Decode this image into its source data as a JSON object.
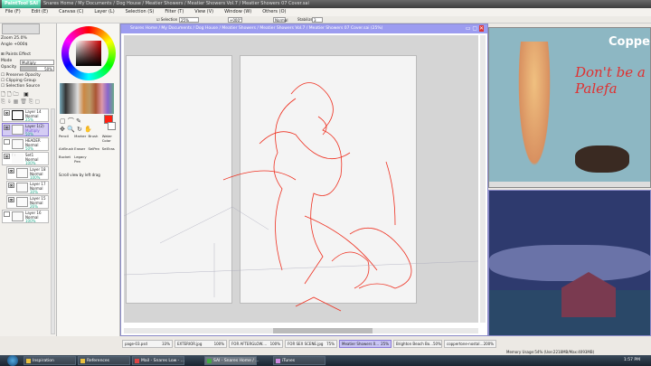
{
  "app": {
    "logo": "PaintTool SAI",
    "title": "Snares Home / My Documents / Dog House / Meatier Showers / Meatier Showers Vol.7 / Meatier Showers 07 Cover.sai"
  },
  "menu": [
    "File (F)",
    "Edit (E)",
    "Canvas (C)",
    "Layer (L)",
    "Selection (S)",
    "Filter (T)",
    "View (V)",
    "Window (W)",
    "Others (O)"
  ],
  "toolbar": {
    "selection_label": "Selection",
    "zoom": "25%",
    "angle": "+000°",
    "blend": "Normal",
    "stabilizer_label": "Stabilizer",
    "stabilizer": "3"
  },
  "navigator": {
    "zoom_label": "Zoom",
    "zoom": "25.0%",
    "angle_label": "Angle",
    "angle": "+000$"
  },
  "layer_props": {
    "paints_effect": "Paints Effect",
    "mode_label": "Mode",
    "mode": "Multiply",
    "opacity_label": "Opacity",
    "opacity": "50%",
    "opacity_value": 50,
    "preserve_opacity": "Preserve Opacity",
    "clipping_group": "Clipping Group",
    "selection_source": "Selection Source"
  },
  "layers": [
    {
      "name": "Layer 14",
      "mode": "Normal",
      "opacity": "25%"
    },
    {
      "name": "Layer 1(2)",
      "mode": "Multiply",
      "opacity": "50%",
      "selected": true
    },
    {
      "name": "HEADER",
      "mode": "Normal",
      "opacity": "50%"
    },
    {
      "name": "Set1",
      "mode": "Normal",
      "opacity": "100%"
    },
    {
      "name": "Layer 18",
      "mode": "Normal",
      "opacity": "100%"
    },
    {
      "name": "Layer 17",
      "mode": "Normal",
      "opacity": "30%"
    },
    {
      "name": "Layer 15",
      "mode": "Normal",
      "opacity": "26%"
    },
    {
      "name": "Layer 16",
      "mode": "Normal",
      "opacity": "100%"
    }
  ],
  "tools": [
    "Pencil",
    "Marker",
    "Brush",
    "Water Color",
    "AirBrush",
    "Eraser",
    "SelPen",
    "SelEras",
    "Bucket",
    "Legacy Pen"
  ],
  "hint": "Scroll view by left drag",
  "colors": {
    "primary": "#ff2010",
    "accent": "#9c9cf0"
  },
  "canvas_title": "Snares Home / My Documents / Dog House / Meatier Showers / Meatier Showers Vol.7 / Meatier Showers 07 Cover.sai (25%)",
  "reference": {
    "brand": "Copper",
    "slogan": "Don't be a Palefa"
  },
  "tabs": [
    {
      "name": "page-03.psd",
      "zoom": "33%"
    },
    {
      "name": "EXTERIOR.jpg",
      "zoom": "100%"
    },
    {
      "name": "FOR AFTERGLOW....",
      "zoom": "100%"
    },
    {
      "name": "FOR SEX SCENE.jpg",
      "zoom": "75%"
    },
    {
      "name": "Meatier Showers 0...",
      "zoom": "25%",
      "active": true
    },
    {
      "name": "Brighton Beach Bo...",
      "zoom": "50%"
    },
    {
      "name": "coppertone-nostal...",
      "zoom": "200%"
    }
  ],
  "status": "Memory Usage:54% (Use:2218MB/Max:4093MB)",
  "taskbar": {
    "items": [
      "Inspiration",
      "References",
      "Mail - Snares Low - ...",
      "SAI - Snares Home / ...",
      "iTunes"
    ],
    "time": "1:57 PM"
  }
}
